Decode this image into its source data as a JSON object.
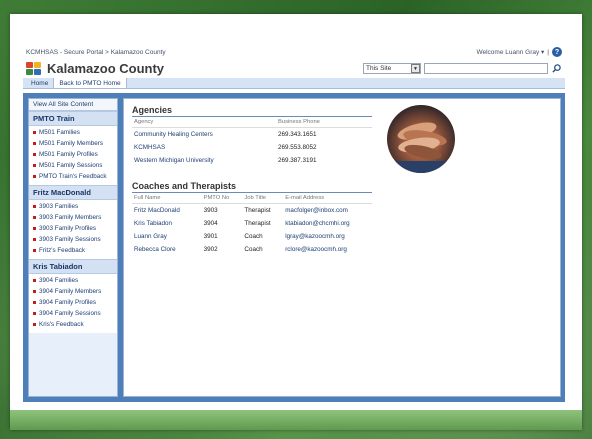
{
  "topbar": {
    "breadcrumb": "KCMHSAS - Secure Portal > Kalamazoo County",
    "welcome": "Welcome Luann Gray ▾",
    "separator": "|"
  },
  "header": {
    "site_title": "Kalamazoo County",
    "scope_value": "This Site",
    "search_value": ""
  },
  "navbar": {
    "items": [
      {
        "label": "Home"
      },
      {
        "label": "Back to PMTO Home"
      }
    ]
  },
  "leftnav": {
    "view_all": "View All Site Content",
    "sections": [
      {
        "heading": "PMTO Train",
        "links": [
          "M501 Families",
          "M501 Family Members",
          "M501 Family Profiles",
          "M501 Family Sessions",
          "PMTO Train's Feedback"
        ]
      },
      {
        "heading": "Fritz MacDonald",
        "links": [
          "3903 Families",
          "3903 Family Members",
          "3903 Family Profiles",
          "3903 Family Sessions",
          "Fritz's Feedback"
        ]
      },
      {
        "heading": "Kris Tabiadon",
        "links": [
          "3904 Families",
          "3904 Family Members",
          "3904 Family Profiles",
          "3904 Family Sessions",
          "Kris's Feedback"
        ]
      }
    ]
  },
  "agencies": {
    "title": "Agencies",
    "columns": [
      "Agency",
      "Business Phone"
    ],
    "rows": [
      [
        "Community Healing Centers",
        "269.343.1651"
      ],
      [
        "KCMHSAS",
        "269.553.8052"
      ],
      [
        "Western Michigan University",
        "269.387.3191"
      ]
    ]
  },
  "coaches": {
    "title": "Coaches and Therapists",
    "columns": [
      "Full Name",
      "PMTO No",
      "Job Title",
      "E-mail Address"
    ],
    "rows": [
      [
        "Fritz MacDonald",
        "3903",
        "Therapist",
        "macfolger@inbox.com"
      ],
      [
        "Kris Tabiadon",
        "3904",
        "Therapist",
        "ktabiadon@chcmhi.org"
      ],
      [
        "Luann Gray",
        "3901",
        "Coach",
        "lgray@kazoocmh.org"
      ],
      [
        "Rebecca Clore",
        "3902",
        "Coach",
        "rclore@kazoocmh.org"
      ]
    ]
  },
  "colors": {
    "accent": "#1d3e73",
    "bullet": "#c21d1d",
    "frame_green": "#2f6a2c",
    "body_blue": "#4f7fb8"
  }
}
